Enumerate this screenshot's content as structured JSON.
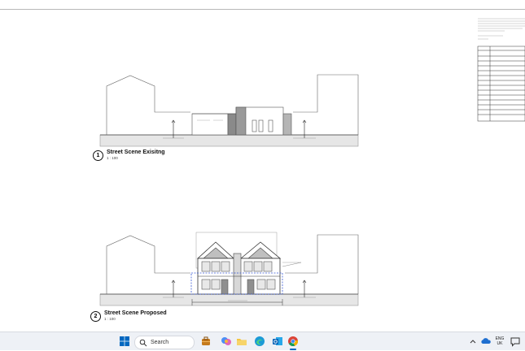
{
  "drawing_1": {
    "number": "1",
    "title": "Street Scene Exisitng",
    "scale": "1 : 100"
  },
  "drawing_2": {
    "number": "2",
    "title": "Street Scene Proposed",
    "scale": "1 : 100"
  },
  "taskbar": {
    "search_label": "Search",
    "language_top": "ENG",
    "language_bottom": "UK",
    "start_icon": "windows-logo",
    "icons": [
      "briefcase-app-icon",
      "copilot-icon",
      "file-explorer-icon",
      "edge-icon",
      "outlook-icon",
      "chrome-icon"
    ],
    "tray_icons": [
      "chevron-up-icon",
      "cloud-icon",
      "chat-icon"
    ]
  },
  "colors": {
    "accent": "#0067c0",
    "taskbar_bg": "#eef1f6",
    "wall_gray": "#7d7d7d",
    "selection_blue": "#3b5bd6"
  }
}
